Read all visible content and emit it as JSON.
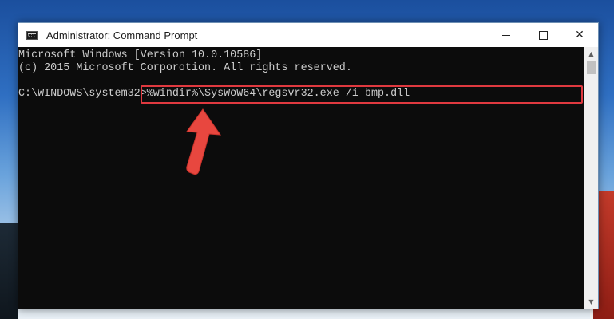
{
  "window": {
    "title": "Administrator: Command Prompt",
    "controls": {
      "minimize": "",
      "maximize": "",
      "close": "✕"
    }
  },
  "console": {
    "lines": [
      "Microsoft Windows [Version 10.0.10586]",
      "(c) 2015 Microsoft Corporotion. All rights reserved.",
      "",
      "C:\\WINDOWS\\system32>%windir%\\SysWoW64\\regsvr32.exe /i bmp.dll"
    ]
  },
  "scrollbar": {
    "up_glyph": "▲",
    "down_glyph": "▼"
  },
  "annotation": {
    "highlight_color": "#e0393f",
    "arrow_color": "#e8473f"
  }
}
